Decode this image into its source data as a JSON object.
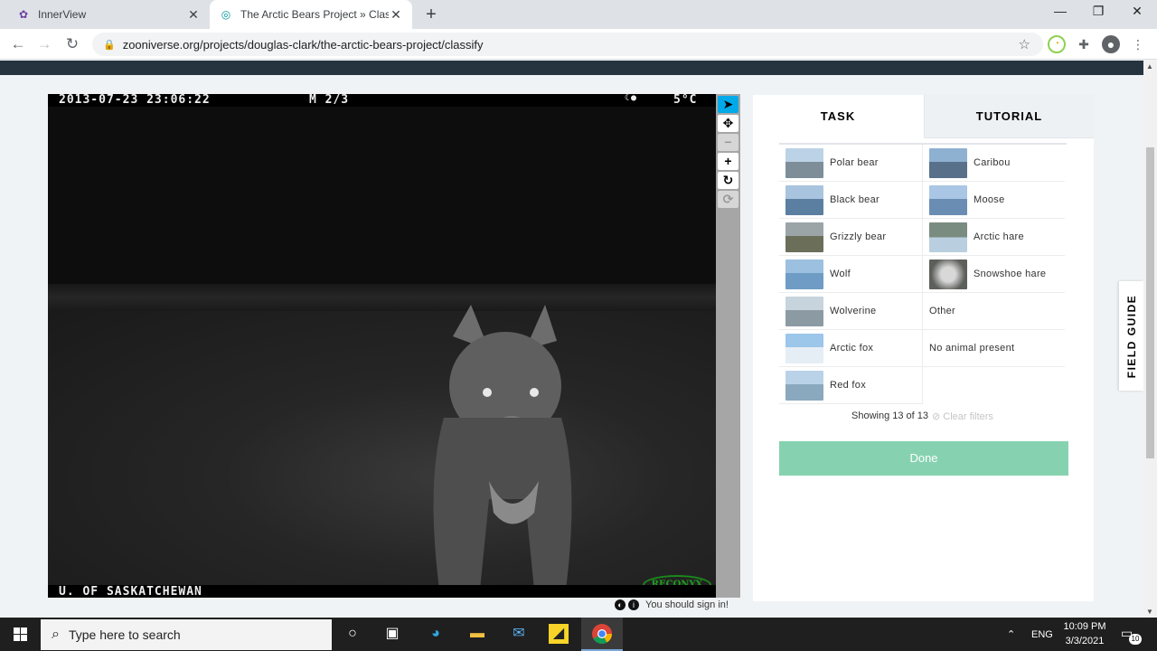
{
  "browser": {
    "tabs": [
      {
        "title": "InnerView",
        "active": false
      },
      {
        "title": "The Arctic Bears Project » Classify",
        "active": true
      }
    ],
    "url": "zooniverse.org/projects/douglas-clark/the-arctic-bears-project/classify"
  },
  "camera": {
    "datetime": "2013-07-23 23:06:22",
    "frame": "M 2/3",
    "temperature": "5°C",
    "credit": "U. OF SASKATCHEWAN",
    "brand": "RECONYX"
  },
  "signin_notice": "You should sign in!",
  "panel": {
    "tabs": {
      "task": "TASK",
      "tutorial": "TUTORIAL"
    },
    "choices_left": [
      {
        "label": "Polar bear",
        "color": "#7d8e98"
      },
      {
        "label": "Black bear",
        "color": "#5a7fa0"
      },
      {
        "label": "Grizzly bear",
        "color": "#6b6f5a"
      },
      {
        "label": "Wolf",
        "color": "#6f9cc4"
      },
      {
        "label": "Wolverine",
        "color": "#8c9aa3"
      },
      {
        "label": "Arctic fox",
        "color": "#b8cfe3"
      },
      {
        "label": "Red fox",
        "color": "#8aa8be"
      }
    ],
    "choices_right": [
      {
        "label": "Caribou",
        "color": "#58708a"
      },
      {
        "label": "Moose",
        "color": "#6a8eb3"
      },
      {
        "label": "Arctic hare",
        "color": "#7a8c80"
      },
      {
        "label": "Snowshoe hare",
        "color": "#8d8f8a"
      },
      {
        "label": "Other"
      },
      {
        "label": "No animal present"
      }
    ],
    "showing": "Showing 13 of 13",
    "clear_filters": "Clear filters",
    "done": "Done"
  },
  "field_guide": "FIELD GUIDE",
  "taskbar": {
    "search_placeholder": "Type here to search",
    "language": "ENG",
    "time": "10:09 PM",
    "date": "3/3/2021",
    "notifications": "10"
  }
}
